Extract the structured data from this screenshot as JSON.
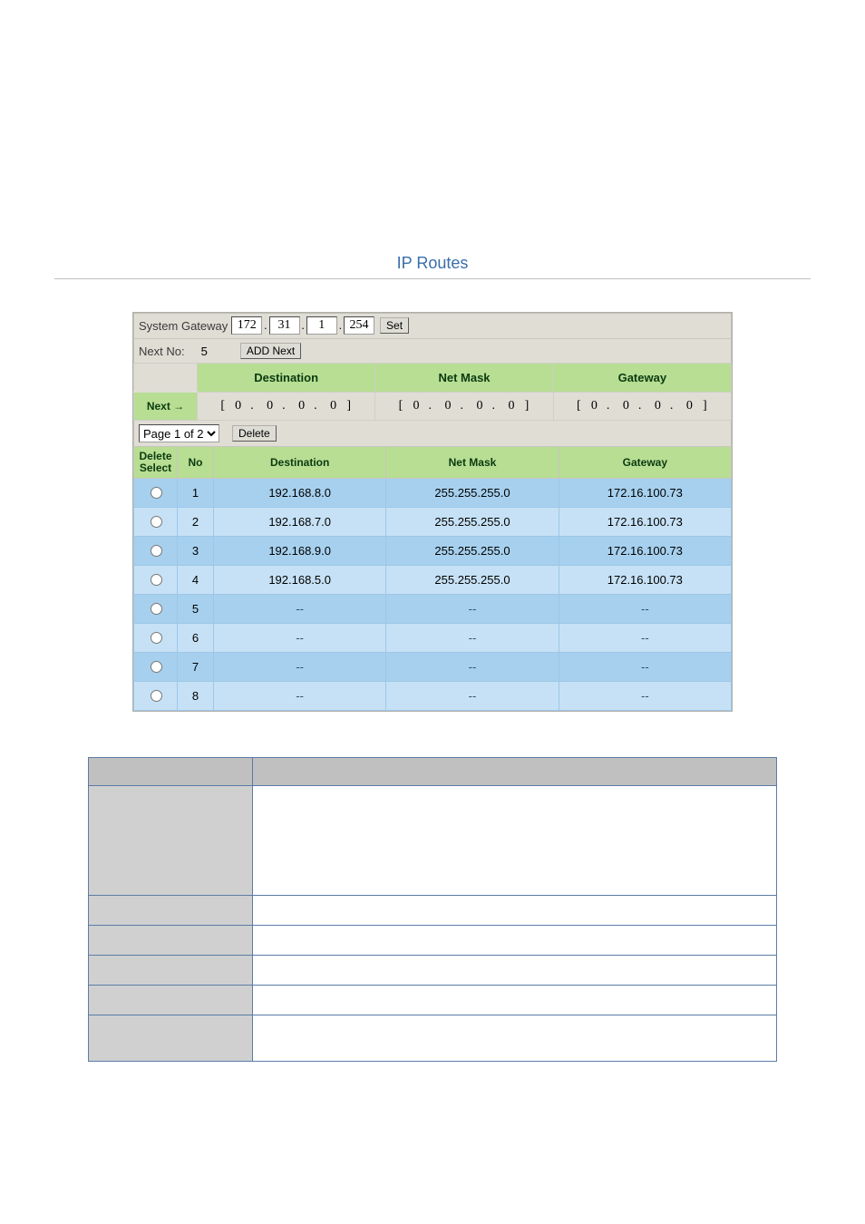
{
  "title": "IP Routes",
  "system_gateway": {
    "label": "System Gateway",
    "octets": [
      "172",
      "31",
      "1",
      "254"
    ],
    "set_button": "Set"
  },
  "next_no": {
    "label": "Next No:",
    "value": "5",
    "add_button": "ADD Next"
  },
  "headers": {
    "destination": "Destination",
    "netmask": "Net Mask",
    "gateway": "Gateway",
    "next_arrow": "Next →"
  },
  "next_inputs": {
    "destination": [
      "0",
      "0",
      "0",
      "0"
    ],
    "netmask": [
      "0",
      "0",
      "0",
      "0"
    ],
    "gateway": [
      "0",
      "0",
      "0",
      "0"
    ]
  },
  "pager": {
    "selected": "Page 1 of 2",
    "delete_button": "Delete"
  },
  "list_headers": {
    "delete_select": "Delete\nSelect",
    "no": "No",
    "destination": "Destination",
    "netmask": "Net Mask",
    "gateway": "Gateway"
  },
  "routes": [
    {
      "no": "1",
      "dest": "192.168.8.0",
      "mask": "255.255.255.0",
      "gw": "172.16.100.73"
    },
    {
      "no": "2",
      "dest": "192.168.7.0",
      "mask": "255.255.255.0",
      "gw": "172.16.100.73"
    },
    {
      "no": "3",
      "dest": "192.168.9.0",
      "mask": "255.255.255.0",
      "gw": "172.16.100.73"
    },
    {
      "no": "4",
      "dest": "192.168.5.0",
      "mask": "255.255.255.0",
      "gw": "172.16.100.73"
    },
    {
      "no": "5",
      "dest": "--",
      "mask": "--",
      "gw": "--"
    },
    {
      "no": "6",
      "dest": "--",
      "mask": "--",
      "gw": "--"
    },
    {
      "no": "7",
      "dest": "--",
      "mask": "--",
      "gw": "--"
    },
    {
      "no": "8",
      "dest": "--",
      "mask": "--",
      "gw": "--"
    }
  ],
  "desc_headers": {
    "param": "",
    "desc": ""
  }
}
